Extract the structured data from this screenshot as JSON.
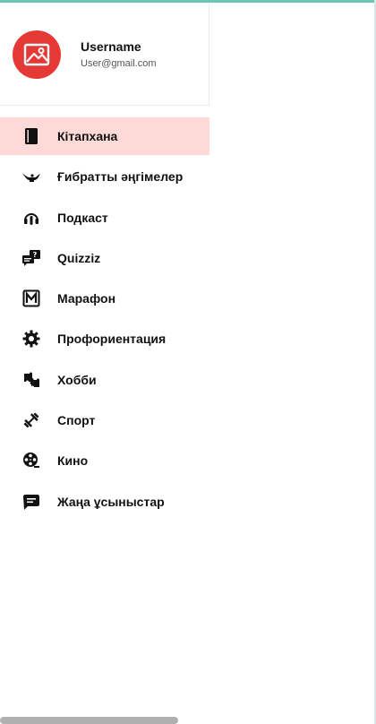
{
  "colors": {
    "accent_top": "#6cc6b6",
    "avatar_bg": "#e53935",
    "active_bg": "#fdd9d8"
  },
  "profile": {
    "username": "Username",
    "email": "User@gmail.com",
    "avatar_icon": "image-icon"
  },
  "menu": {
    "items": [
      {
        "label": "Кітапхана",
        "icon": "book-icon",
        "active": true
      },
      {
        "label": "Ғибратты әңгімелер",
        "icon": "magic-lamp-icon"
      },
      {
        "label": "Подкаст",
        "icon": "podcast-icon"
      },
      {
        "label": "Quizziz",
        "icon": "quiz-chat-icon"
      },
      {
        "label": "Марафон",
        "icon": "marathon-m-icon"
      },
      {
        "label": "Профориентация",
        "icon": "gear-icon"
      },
      {
        "label": "Хобби",
        "icon": "puzzle-icon"
      },
      {
        "label": "Спорт",
        "icon": "dumbbell-icon"
      },
      {
        "label": "Кино",
        "icon": "film-reel-icon"
      },
      {
        "label": "Жаңа ұсыныстар",
        "icon": "message-icon"
      }
    ]
  }
}
